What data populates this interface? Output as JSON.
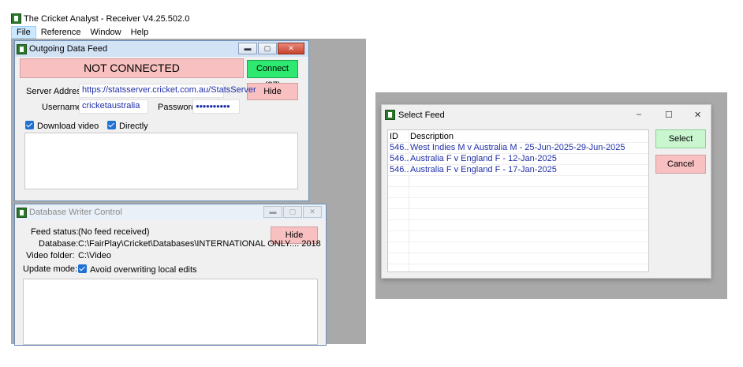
{
  "app": {
    "title": "The Cricket Analyst - Receiver V4.25.502.0",
    "menu": [
      "File",
      "Reference",
      "Window",
      "Help"
    ]
  },
  "outgoing": {
    "title": "Outgoing Data Feed",
    "status": "NOT CONNECTED",
    "connect_label": "Connect (27)",
    "hide_label": "Hide",
    "server_label": "Server Address:",
    "server_value": "https://statsserver.cricket.com.au/StatsServer",
    "username_label": "Username:",
    "username_value": "cricketaustralia",
    "password_label": "Password:",
    "password_value": "●●●●●●●●●●",
    "download_video_label": "Download video",
    "directly_label": "Directly"
  },
  "dbwriter": {
    "title": "Database Writer Control",
    "hide_label": "Hide",
    "feed_status_label": "Feed status:",
    "feed_status_value": "(No feed received)",
    "database_label": "Database:",
    "database_value": "C:\\FairPlay\\Cricket\\Databases\\INTERNATIONAL ONLY.... 2018",
    "video_folder_label": "Video folder:",
    "video_folder_value": "C:\\Video",
    "update_mode_label": "Update mode:",
    "avoid_overwrite_label": "Avoid overwriting local edits"
  },
  "select_feed": {
    "title": "Select Feed",
    "col_id": "ID",
    "col_description": "Description",
    "rows": [
      {
        "id": "546...",
        "description": "West Indies M v Australia M - 25-Jun-2025-29-Jun-2025"
      },
      {
        "id": "546...",
        "description": "Australia F v England F - 12-Jan-2025"
      },
      {
        "id": "546...",
        "description": "Australia F v England F - 17-Jan-2025"
      }
    ],
    "select_label": "Select",
    "cancel_label": "Cancel",
    "minimize_glyph": "–",
    "maximize_glyph": "☐",
    "close_glyph": "✕"
  },
  "colors": {
    "status_pink": "#f8c0c0",
    "connect_green": "#2fe870",
    "link_blue": "#1f2fa8",
    "mdi_background": "#a9a9a9"
  },
  "icons": [
    "app-icon",
    "checkbox-checked-icon",
    "minimize-icon",
    "maximize-icon",
    "close-icon"
  ]
}
